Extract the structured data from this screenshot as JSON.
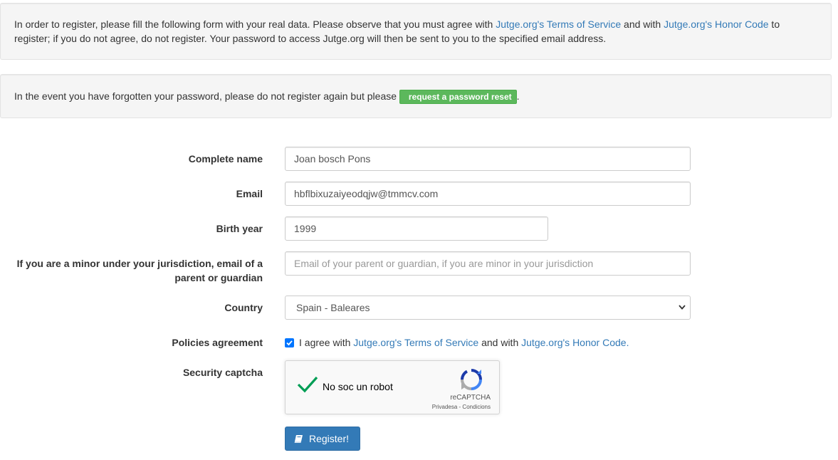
{
  "notices": {
    "register": {
      "text_before": "In order to register, please fill the following form with your real data. Please observe that you must agree with ",
      "terms_link": "Jutge.org's Terms of Service",
      "text_middle": " and with ",
      "honor_link": "Jutge.org's Honor Code",
      "text_after": " to register; if you do not agree, do not register. Your password to access Jutge.org will then be sent to you to the specified email address."
    },
    "forgot": {
      "text_before": "In the event you have forgotten your password, please do not register again but please ",
      "button_label": "request a password reset",
      "text_after": "."
    }
  },
  "form": {
    "complete_name": {
      "label": "Complete name",
      "value": "Joan bosch Pons"
    },
    "email": {
      "label": "Email",
      "value": "hbflbixuzaiyeodqjw@tmmcv.com"
    },
    "birth_year": {
      "label": "Birth year",
      "value": "1999"
    },
    "guardian_email": {
      "label": "If you are a minor under your jurisdiction, email of a parent or guardian",
      "placeholder": "Email of your parent or guardian, if you are minor in your jurisdiction"
    },
    "country": {
      "label": "Country",
      "value": "Spain - Baleares"
    },
    "policies": {
      "label": "Policies agreement",
      "checked": true,
      "text_before": "I agree with ",
      "terms_link": "Jutge.org's Terms of Service",
      "text_middle": " and with ",
      "honor_link": "Jutge.org's Honor Code."
    },
    "captcha": {
      "label": "Security captcha",
      "text": "No soc un robot",
      "brand": "reCAPTCHA",
      "terms": "Privadesa - Condicions"
    },
    "register_button": {
      "label": "Register!",
      "icon": "book-icon"
    }
  },
  "colors": {
    "link": "#337ab7",
    "success_button": "#5cb85c",
    "primary_button": "#337ab7",
    "checkbox": "#0075ff",
    "captcha_check": "#009e55"
  }
}
